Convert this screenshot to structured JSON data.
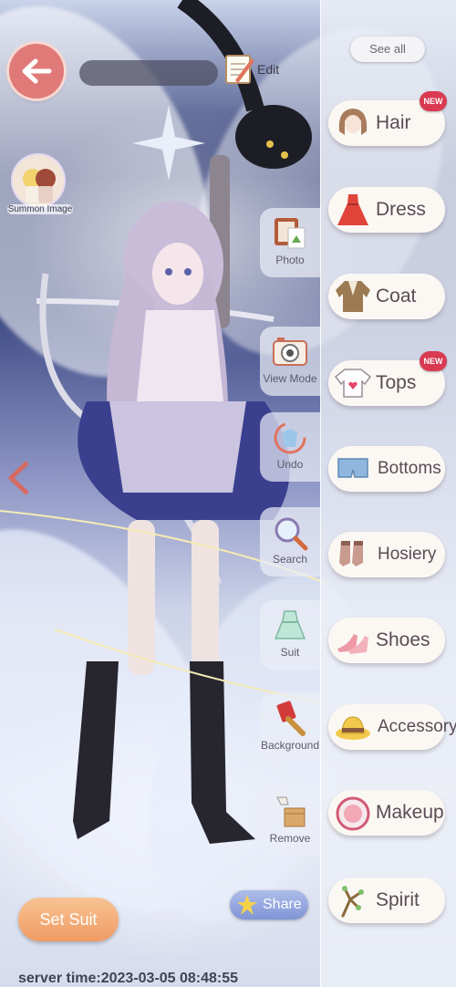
{
  "header": {
    "edit_label": "Edit"
  },
  "summon": {
    "label": "Summon Image"
  },
  "catalog": {
    "see_all": "See all",
    "new_badge": "NEW",
    "items": [
      {
        "label": "Hair",
        "icon": "hair-icon",
        "new": true
      },
      {
        "label": "Dress",
        "icon": "dress-icon",
        "new": false
      },
      {
        "label": "Coat",
        "icon": "coat-icon",
        "new": false
      },
      {
        "label": "Tops",
        "icon": "tops-icon",
        "new": true
      },
      {
        "label": "Bottoms",
        "icon": "bottoms-icon",
        "new": false
      },
      {
        "label": "Hosiery",
        "icon": "hosiery-icon",
        "new": false
      },
      {
        "label": "Shoes",
        "icon": "shoes-icon",
        "new": false
      },
      {
        "label": "Accessory",
        "icon": "accessory-icon",
        "new": false
      },
      {
        "label": "Makeup",
        "icon": "makeup-icon",
        "new": false
      },
      {
        "label": "Spirit",
        "icon": "spirit-icon",
        "new": false
      }
    ]
  },
  "tools": [
    {
      "label": "Photo",
      "icon": "photo-icon"
    },
    {
      "label": "View Mode",
      "icon": "camera-icon"
    },
    {
      "label": "Undo",
      "icon": "undo-icon"
    },
    {
      "label": "Search",
      "icon": "search-icon"
    },
    {
      "label": "Suit",
      "icon": "suit-icon"
    },
    {
      "label": "Background",
      "icon": "paint-brush-icon"
    },
    {
      "label": "Remove",
      "icon": "remove-icon"
    }
  ],
  "footer": {
    "set_suit_label": "Set Suit",
    "share_label": "Share",
    "server_time": "server time:2023-03-05 08:48:55"
  },
  "colors": {
    "accent_orange": "#f09a62",
    "back_button": "#e07a78",
    "new_badge": "#d93a52",
    "share_blue": "#7f95d5"
  }
}
